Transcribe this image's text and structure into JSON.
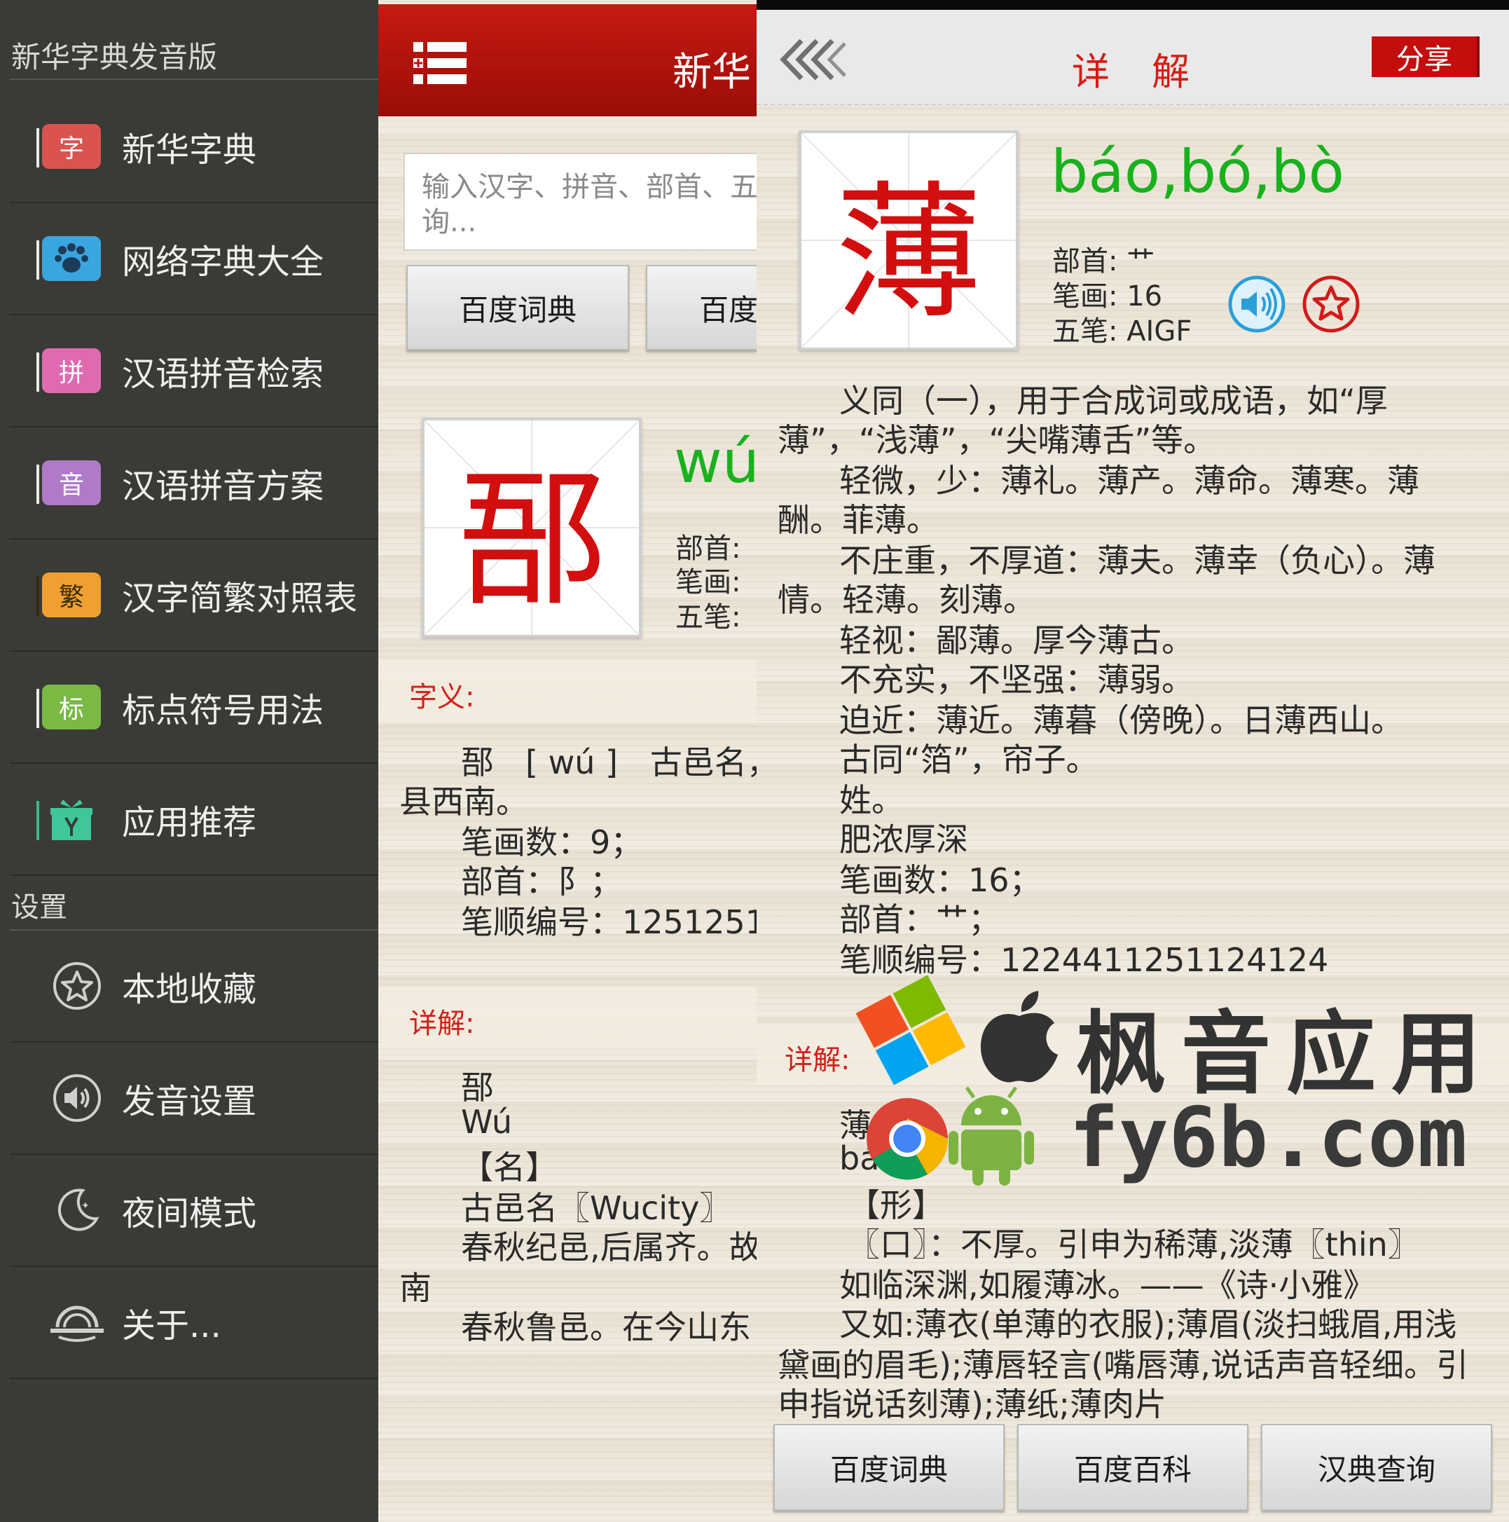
{
  "sidebar": {
    "app_title": "新华字典发音版",
    "items": [
      {
        "icon_char": "字",
        "label": "新华字典",
        "icon_color": "#d9534f"
      },
      {
        "icon_char": "",
        "label": "网络字典大全",
        "icon_color": "#3aa6e0"
      },
      {
        "icon_char": "拼",
        "label": "汉语拼音检索",
        "icon_color": "#e06ab0"
      },
      {
        "icon_char": "音",
        "label": "汉语拼音方案",
        "icon_color": "#b07ac8"
      },
      {
        "icon_char": "繁",
        "label": "汉字简繁对照表",
        "icon_color": "#f0a030"
      },
      {
        "icon_char": "标",
        "label": "标点符号用法",
        "icon_color": "#79b944"
      },
      {
        "icon_char": "",
        "label": "应用推荐",
        "icon_color": "#3fc69a"
      }
    ],
    "settings_label": "设置",
    "settings_items": [
      {
        "label": "本地收藏",
        "icon": "star-icon"
      },
      {
        "label": "发音设置",
        "icon": "speaker-icon"
      },
      {
        "label": "夜间模式",
        "icon": "moon-icon"
      },
      {
        "label": "关于...",
        "icon": "about-icon"
      }
    ]
  },
  "panel2": {
    "header_title": "新华",
    "search_placeholder": "输入汉字、拼音、部首、五\n询...",
    "buttons": [
      "百度词典",
      "百度"
    ],
    "char": "郚",
    "pinyin": "wú",
    "meta": [
      "部首:",
      "笔画:",
      "五笔:"
    ],
    "meaning_label": "字义:",
    "meaning_lines": [
      "郚　[ wú ]　古邑名，",
      "县西南。",
      "笔画数：9；",
      "部首：阝；",
      "笔顺编号：1251251"
    ],
    "detail_label": "详解:",
    "detail_lines": [
      "郚",
      "Wú",
      "【名】",
      "古邑名〖Wucity〗",
      "春秋纪邑,后属齐。故",
      "南",
      "春秋鲁邑。在今山东"
    ]
  },
  "panel3": {
    "header_title": "详解",
    "share_label": "分享",
    "char": "薄",
    "pinyin": "báo,bó,bò",
    "meta": [
      "部首:  艹",
      "笔画:  16",
      "五笔:  AIGF"
    ],
    "meaning_lines": [
      "义同（一），用于合成词或成语，如“厚",
      "薄”，“浅薄”，“尖嘴薄舌”等。",
      "轻微，少：薄礼。薄产。薄命。薄寒。薄",
      "酬。菲薄。",
      "不庄重，不厚道：薄夫。薄幸（负心）。薄",
      "情。轻薄。刻薄。",
      "轻视：鄙薄。厚今薄古。",
      "不充实，不坚强：薄弱。",
      "迫近：薄近。薄暮（傍晚）。日薄西山。",
      "古同“箔”，帘子。",
      "姓。",
      "肥浓厚深",
      "笔画数：16；",
      "部首：艹；",
      "笔顺编号：1224411251124124"
    ],
    "detail_label": "详解:",
    "detail_lines": [
      "薄",
      "báo",
      "【形】",
      "〖口〗：不厚。引申为稀薄,淡薄〖thin〗",
      "如临深渊,如履薄冰。——《诗·小雅》",
      "又如:薄衣(单薄的衣服);薄眉(淡扫蛾眉,用浅",
      "黛画的眉毛);薄唇轻言(嘴唇薄,说话声音轻细。引",
      "申指说话刻薄);薄纸;薄肉片"
    ],
    "bottom_buttons": [
      "百度词典",
      "百度百科",
      "汉典查询"
    ]
  },
  "watermark": {
    "line1": "枫音应用",
    "line2": "fy6b.com"
  },
  "colors": {
    "header_red": "#b5130c",
    "accent_red": "#d20e0e",
    "pinyin_green": "#19b11e",
    "sidebar_bg": "#3a3a36"
  }
}
